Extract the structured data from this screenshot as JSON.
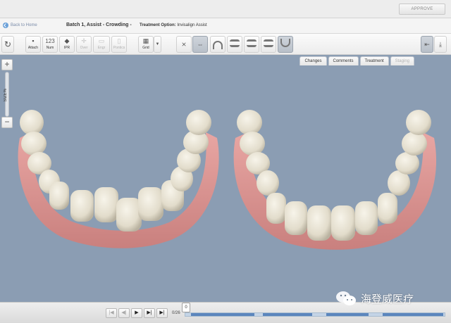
{
  "topbar": {
    "approve_label": "APPROVE"
  },
  "infobar": {
    "back_label": "Back to Home",
    "case_title": "Batch 1, Assist - Crowding -",
    "treatment_option_label": "Treatment Option:",
    "treatment_option_value": "Invisalign Assist"
  },
  "toolbar": {
    "attach": "Attach",
    "num_value": "123",
    "num": "Num",
    "ipr": "IPR",
    "over": "Over",
    "engr": "Engr",
    "pontics": "Pontics",
    "grid": "Grid"
  },
  "tabs": [
    "Changes",
    "Comments",
    "Treatment",
    "Staging"
  ],
  "size_control": {
    "label": "SIZE%",
    "plus": "+",
    "minus": "−"
  },
  "playback": {
    "counter": "0/26",
    "thumb_value": "0",
    "first": "|◀",
    "prev": "◀|",
    "play": "▶",
    "next": "▶|",
    "last": "▶|"
  },
  "watermark": {
    "text": "海登威医疗"
  },
  "colors": {
    "viewport_bg": "#8b9db3",
    "gum": "#e3a19f",
    "tooth": "#ece8da",
    "timeline_fill": "#5b86bd"
  },
  "icons": {
    "reset": "refresh-icon",
    "attach": "attachment-icon",
    "ipr": "diamond-icon",
    "over": "crosshair-icon",
    "grid": "grid-icon",
    "view_export": "download-icon"
  }
}
